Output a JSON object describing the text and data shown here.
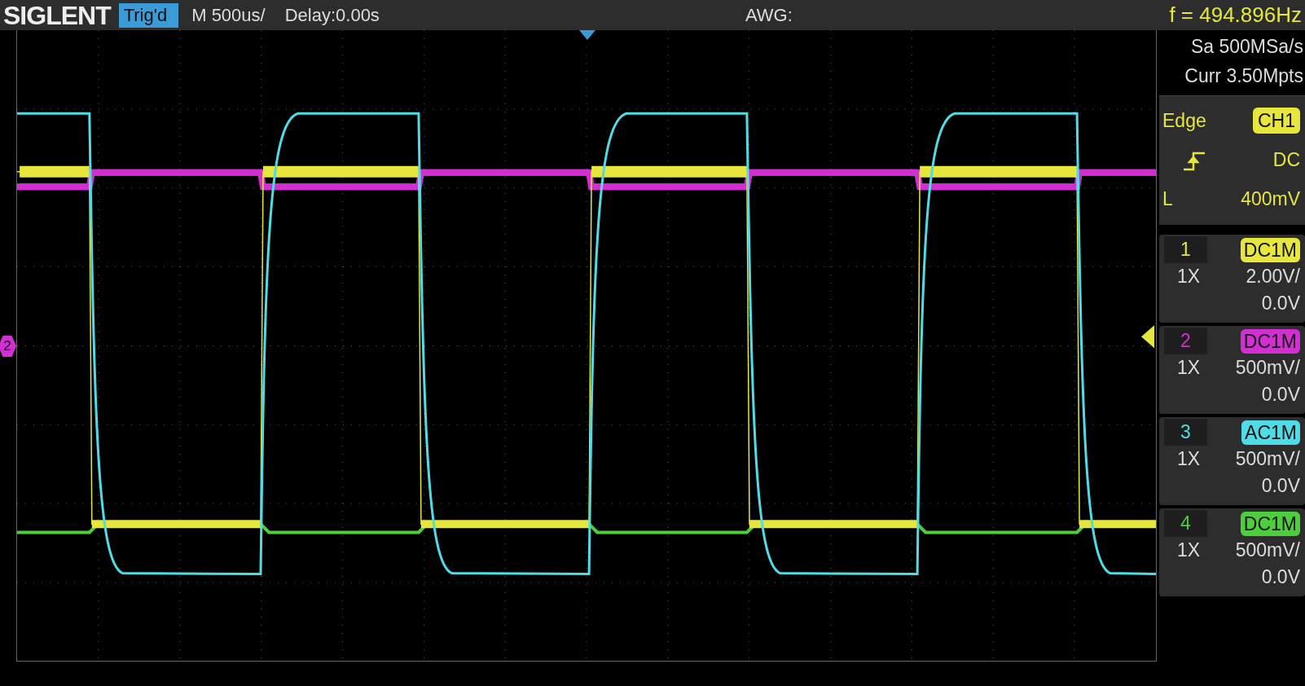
{
  "brand": "SIGLENT",
  "trigger_status": "Trig'd",
  "timebase": "M 500us/",
  "delay": "Delay:0.00s",
  "awg": "AWG:",
  "frequency": "f = 494.896Hz",
  "acquisition": {
    "sample_rate": "Sa 500MSa/s",
    "memory": "Curr 3.50Mpts"
  },
  "trigger": {
    "type": "Edge",
    "source": "CH1",
    "coupling": "DC",
    "level_label": "L",
    "level_value": "400mV"
  },
  "channel_marker": "2",
  "channels": [
    {
      "number": "1",
      "coupling": "DC1M",
      "probe": "1X",
      "scale": "2.00V/",
      "offset": "0.0V",
      "color": "#e6e63c"
    },
    {
      "number": "2",
      "coupling": "DC1M",
      "probe": "1X",
      "scale": "500mV/",
      "offset": "0.0V",
      "color": "#d22fd2"
    },
    {
      "number": "3",
      "coupling": "AC1M",
      "probe": "1X",
      "scale": "500mV/",
      "offset": "0.0V",
      "color": "#4fdce6"
    },
    {
      "number": "4",
      "coupling": "DC1M",
      "probe": "1X",
      "scale": "500mV/",
      "offset": "0.0V",
      "color": "#4ccf3a"
    }
  ]
}
